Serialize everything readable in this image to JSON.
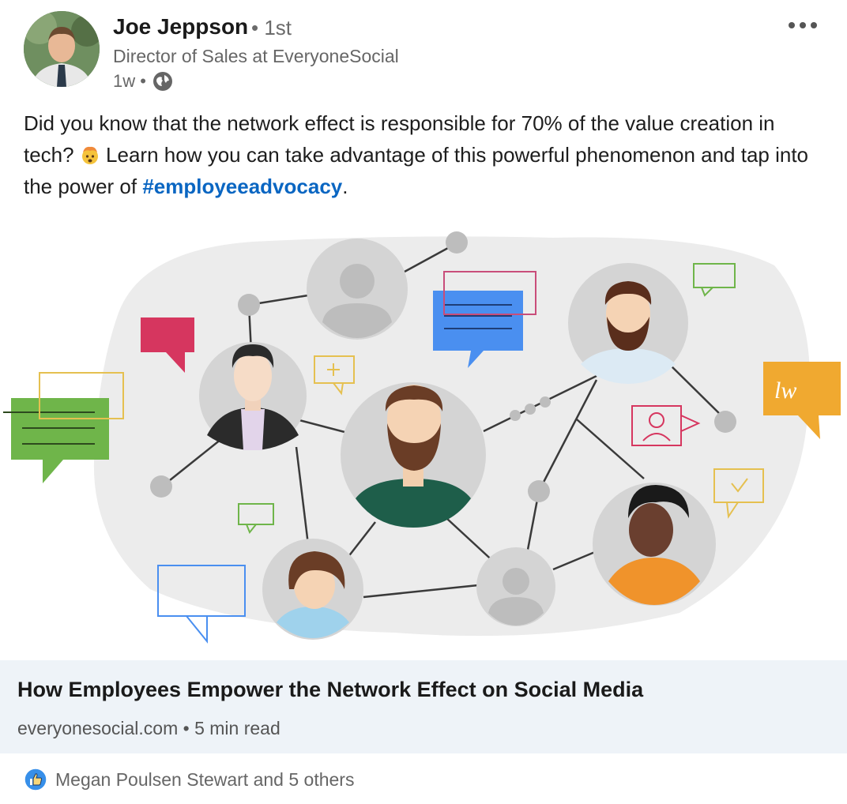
{
  "author": {
    "name": "Joe Jeppson",
    "degree": "• 1st",
    "headline": "Director of Sales at EveryoneSocial",
    "time": "1w •",
    "visibility_icon": "globe-icon"
  },
  "post": {
    "text_before": "Did you know that the network effect is responsible for 70% of the value creation in tech? ",
    "emoji": "exploding-head-emoji",
    "text_middle": " Learn how you can take advantage of this powerful phenomenon and tap into the power of ",
    "hashtag": "#employeeadvocacy",
    "text_after": "."
  },
  "illustration": {
    "signature_text": "lw"
  },
  "link_card": {
    "title": "How Employees Empower the Network Effect on Social Media",
    "meta": "everyonesocial.com • 5 min read"
  },
  "reactions": {
    "icon": "like-icon",
    "summary": "Megan Poulsen Stewart and 5 others"
  },
  "colors": {
    "link": "#0a66c2",
    "card_bg": "#eef3f8",
    "like_blue": "#378fe9"
  }
}
